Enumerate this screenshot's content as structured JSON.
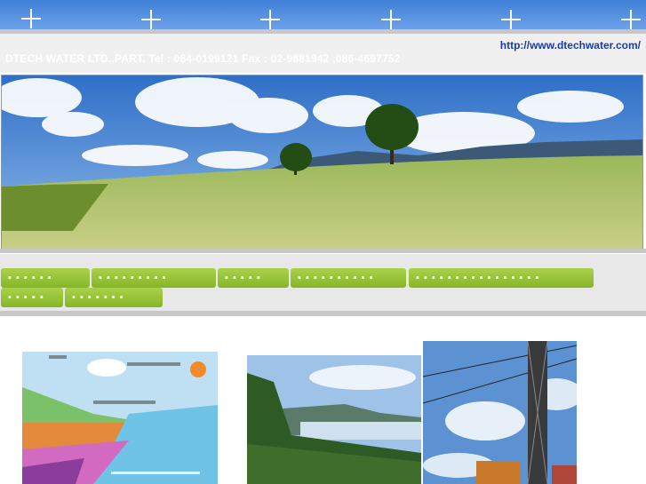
{
  "site": {
    "url": "http://www.dtechwater.com/",
    "company_line": "DTECH WATER LTD.,PART. Tel : 084-0199121 Fax : 02-9881942 ,086-4697752"
  },
  "nav": {
    "items": [
      {
        "label": "▪ ▪ ▪ ▪ ▪ ▪"
      },
      {
        "label": "▪ ▪ ▪ ▪ ▪ ▪ ▪ ▪ ▪"
      },
      {
        "label": "▪ ▪ ▪ ▪ ▪"
      },
      {
        "label": "▪ ▪ ▪ ▪ ▪ ▪ ▪ ▪ ▪ ▪"
      },
      {
        "label": "▪ ▪ ▪ ▪ ▪ ▪ ▪ ▪ ▪ ▪ ▪ ▪ ▪ ▪ ▪ ▪"
      },
      {
        "label": "▪ ▪ ▪ ▪ ▪"
      },
      {
        "label": "▪ ▪ ▪ ▪ ▪ ▪ ▪"
      }
    ]
  },
  "colors": {
    "topbar": "#4a86dc",
    "nav_green": "#97c43a",
    "url_blue": "#1a3aa8"
  }
}
